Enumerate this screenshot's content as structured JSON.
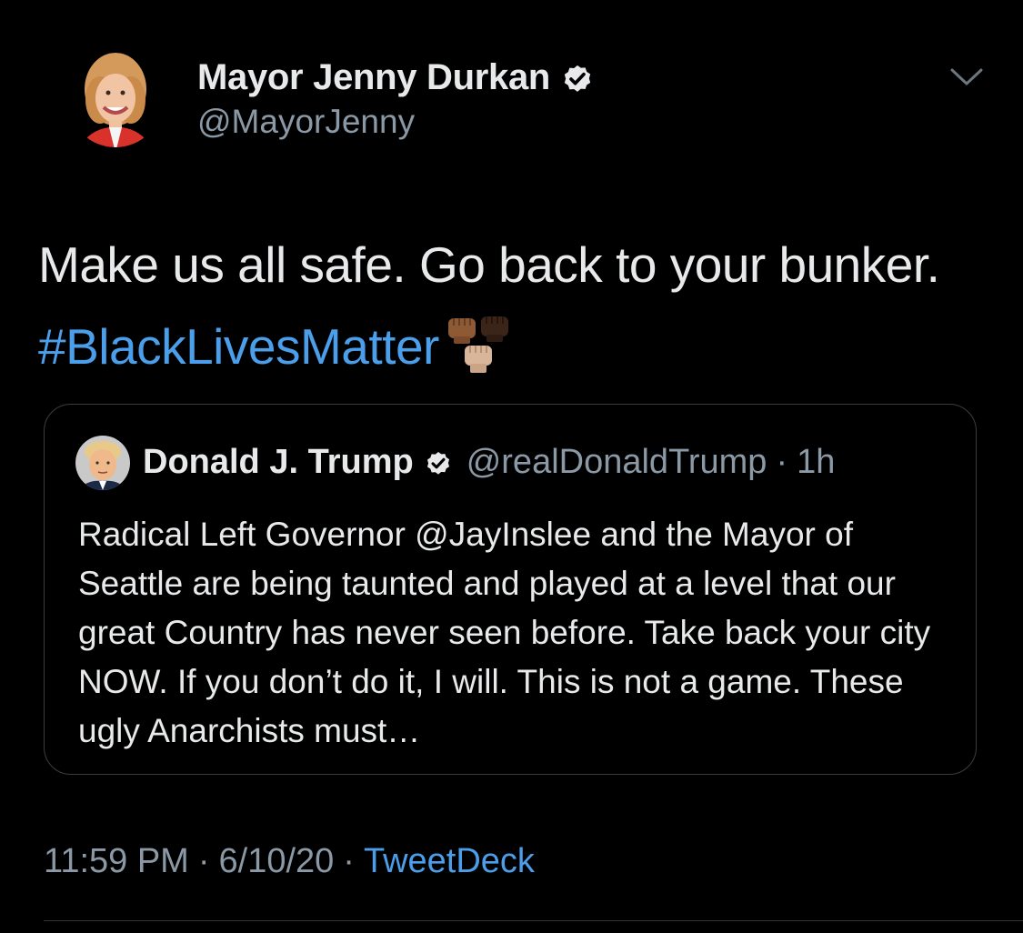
{
  "author": {
    "name": "Mayor Jenny Durkan",
    "handle": "@MayorJenny",
    "verified": true
  },
  "tweet": {
    "text_prefix": "Make us all safe. Go back to your bunker.",
    "hashtag": "#BlackLivesMatter",
    "emoji": "raised-fist-emoji"
  },
  "quoted_tweet": {
    "name": "Donald J. Trump",
    "verified": true,
    "handle": "@realDonaldTrump",
    "separator": "·",
    "time": "1h",
    "text": "Radical Left Governor @JayInslee and the Mayor of Seattle are being taunted and played at a level that our great Country has never seen before. Take back your city NOW. If you don’t do it, I will. This is not a game. These ugly Anarchists must…"
  },
  "meta": {
    "time": "11:59 PM",
    "separator": "·",
    "date": "6/10/20",
    "source": "TweetDeck"
  },
  "colors": {
    "background": "#000000",
    "link": "#4a9eea",
    "secondary_text": "#8b98a5",
    "primary_text": "#e7e9ea"
  }
}
